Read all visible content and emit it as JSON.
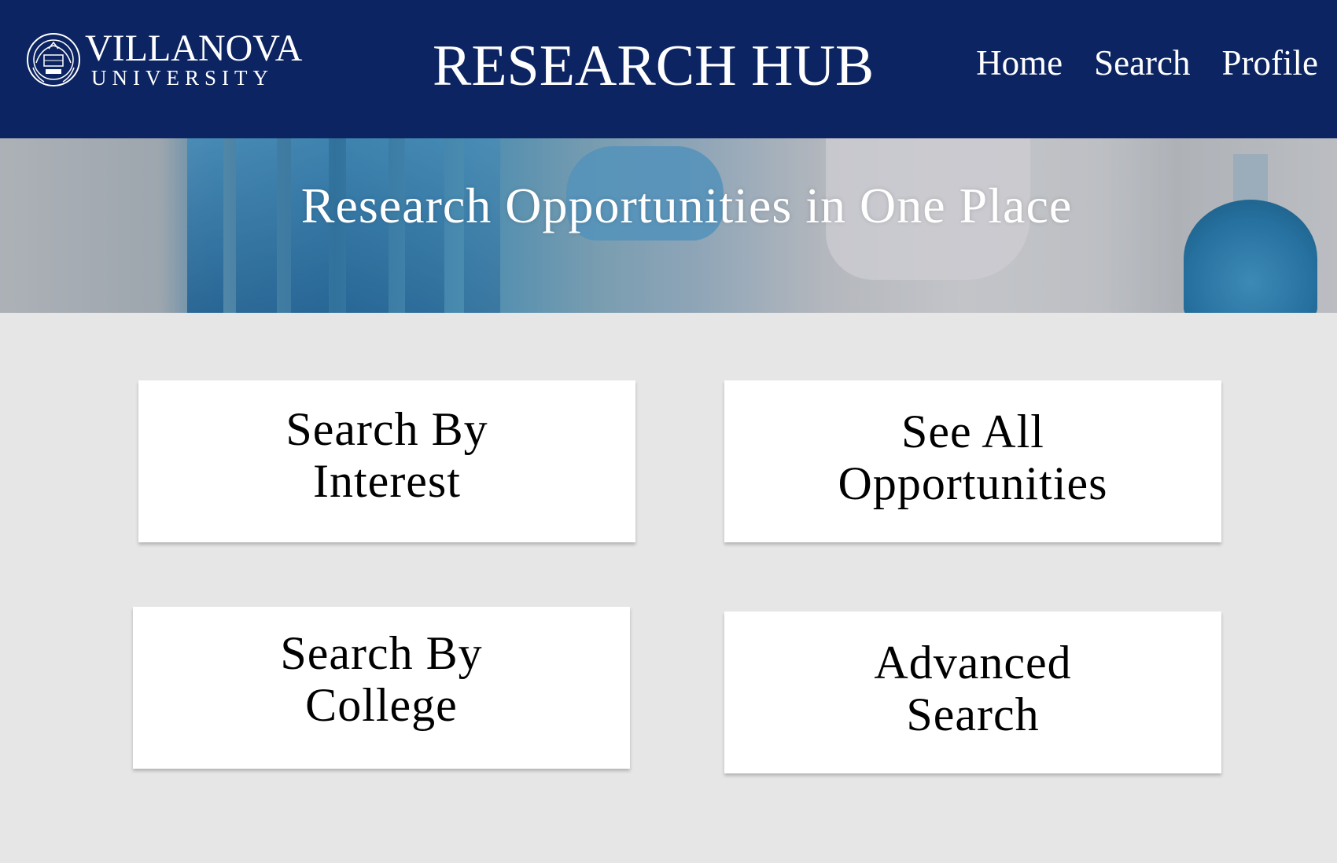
{
  "header": {
    "logo": {
      "name": "VILLANOVA",
      "subtitle": "UNIVERSITY",
      "seal_icon": "university-seal-icon"
    },
    "title": "RESEARCH HUB",
    "nav": [
      {
        "label": "Home"
      },
      {
        "label": "Search"
      },
      {
        "label": "Profile"
      }
    ],
    "background_color": "#0c2461"
  },
  "hero": {
    "title": "Research Opportunities in One Place"
  },
  "cards": [
    {
      "label": "Search By\nInterest"
    },
    {
      "label": "See All\nOpportunities"
    },
    {
      "label": "Search By\nCollege"
    },
    {
      "label": "Advanced\nSearch"
    }
  ],
  "colors": {
    "page_background": "#e6e6e6",
    "card_background": "#ffffff",
    "text_light": "#ffffff",
    "text_dark": "#000000"
  }
}
